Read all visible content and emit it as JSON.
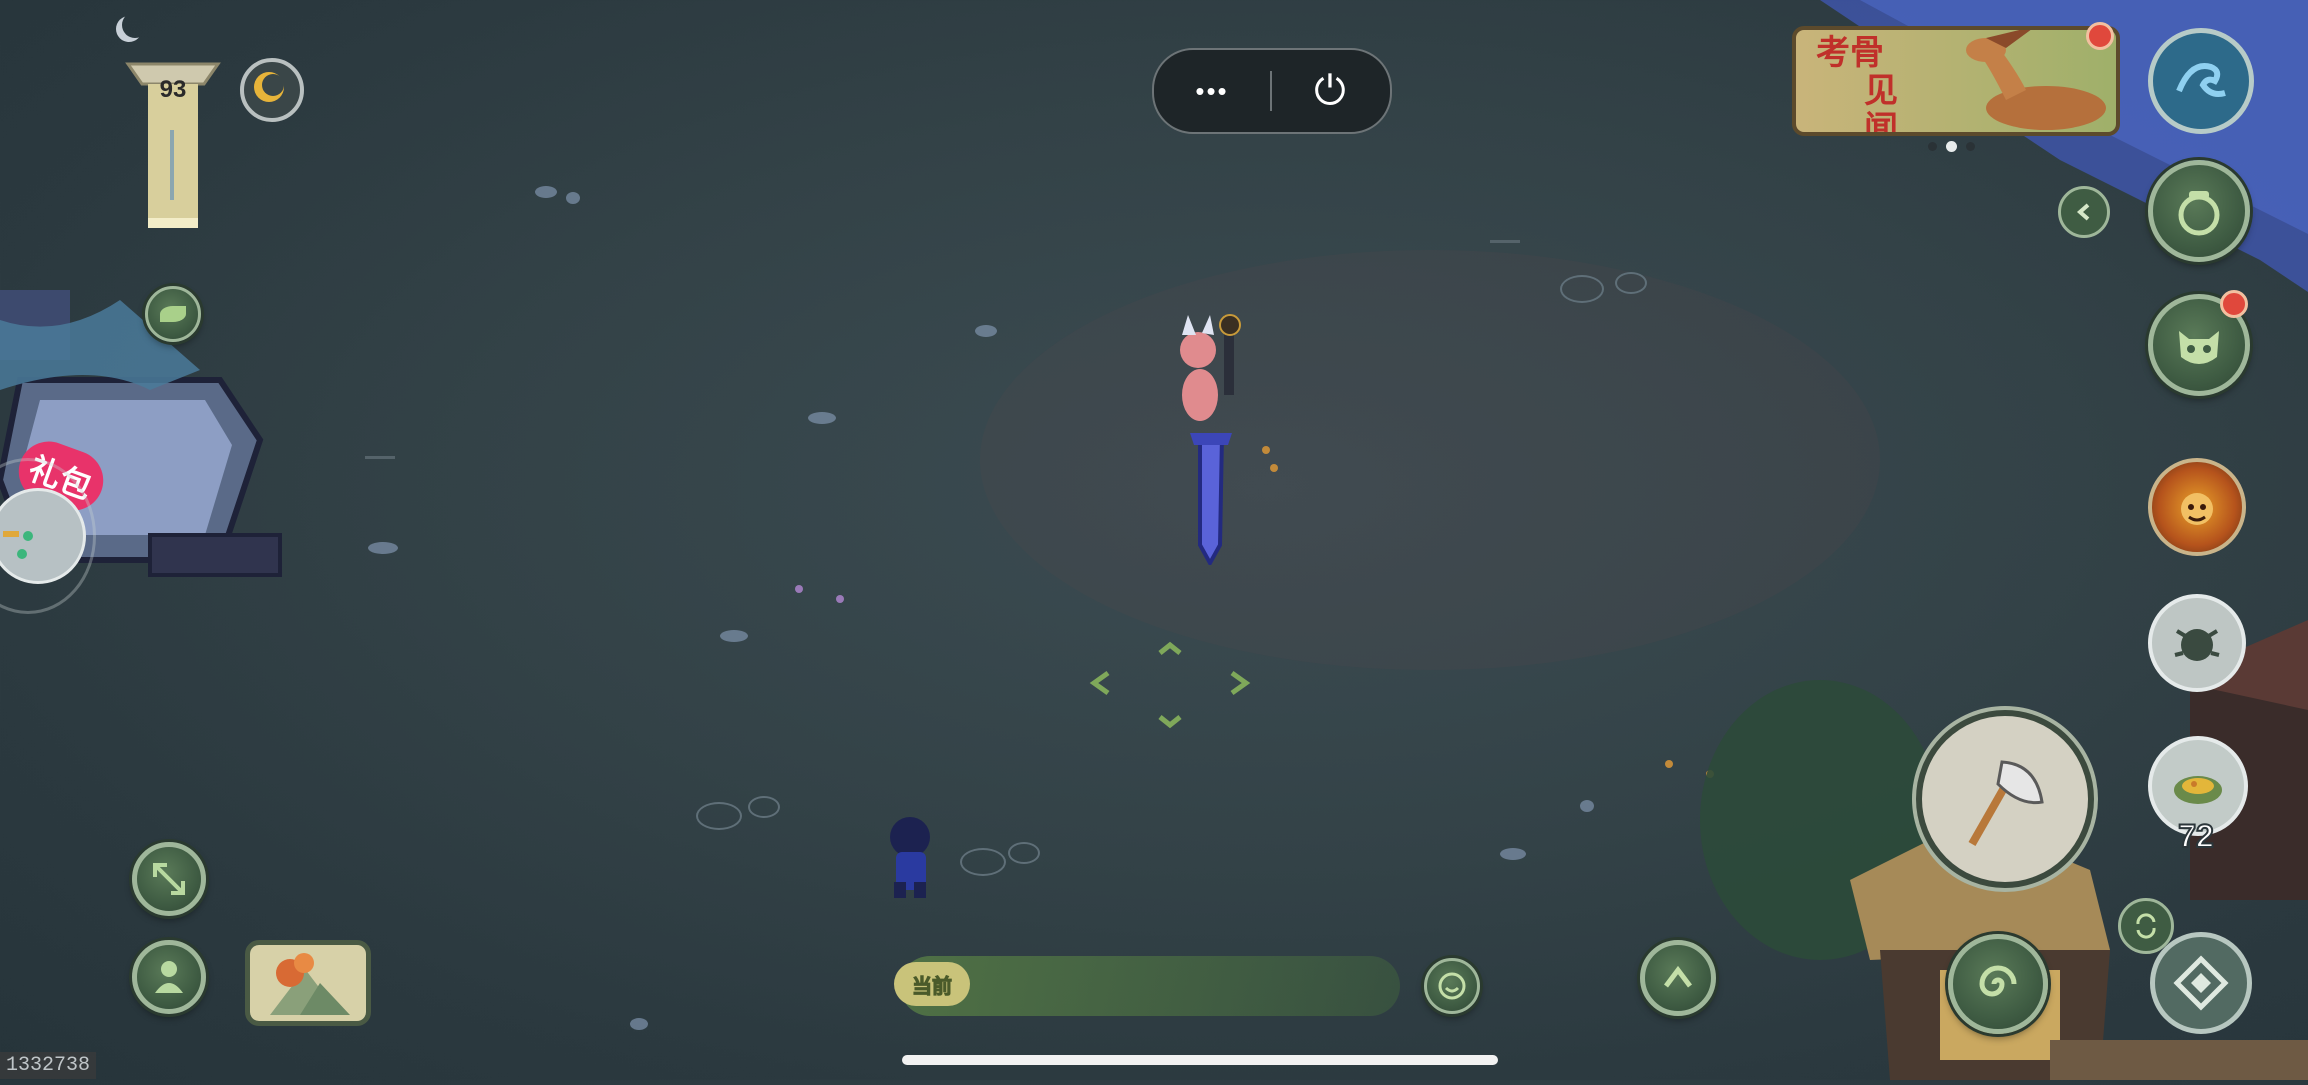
{
  "hud": {
    "top_left": {
      "energy_value": "93"
    },
    "capsule": {
      "more_label": "•••",
      "power_label": "⏻"
    },
    "event_banner": {
      "title_line1": "考骨",
      "title_line2": "见闻"
    },
    "gift_badge": {
      "label": "礼包"
    },
    "current_chat": {
      "label": "当前"
    },
    "item_count": "72",
    "player_id": "1332738"
  },
  "colors": {
    "ground": "#334247",
    "ui_green": "#3f5c43",
    "ui_border": "#9fb79a",
    "notify_red": "#e0483c",
    "gift_pink": "#e8336a"
  },
  "icons": {
    "left": [
      "tower-icon",
      "moon-orb-icon",
      "leaf-icon",
      "expand-icon",
      "character-icon",
      "map-thumbnail-icon",
      "gamepad-icon"
    ],
    "right": [
      "wave-icon",
      "pot-icon",
      "monster-icon",
      "beast-face-icon",
      "bug-icon",
      "food-bowl-icon",
      "axe-icon",
      "jump-icon",
      "spiral-icon",
      "swap-icon",
      "diamond-icon",
      "back-chevron-icon"
    ]
  }
}
